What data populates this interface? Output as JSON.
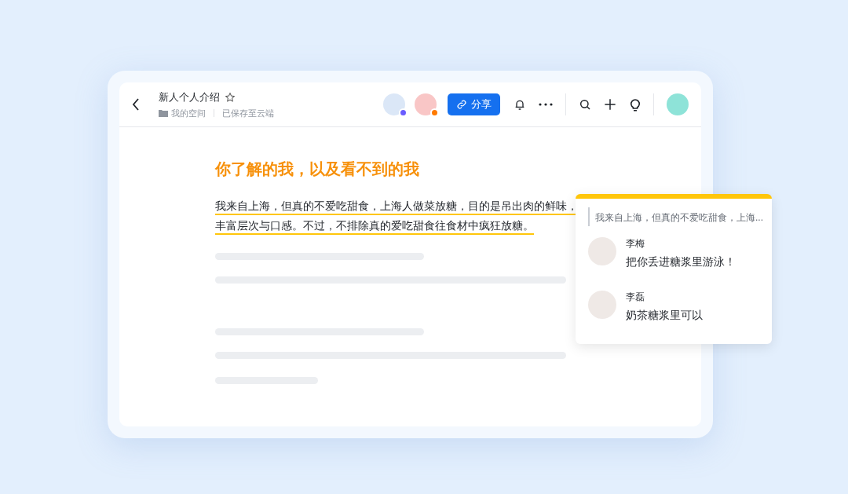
{
  "header": {
    "title": "新人个人介绍",
    "folder": "我的空间",
    "save_status": "已保存至云端",
    "collaborators": [
      {
        "color": "#6a5cff"
      },
      {
        "color": "#ff7a00"
      }
    ],
    "share_button": "分享"
  },
  "document": {
    "heading": "你了解的我，以及看不到的我",
    "paragraph": "我来自上海，但真的不爱吃甜食，上海人做菜放糖，目的是吊出肉的鲜味，丰富层次与口感。不过，不排除真的爱吃甜食往食材中疯狂放糖。"
  },
  "comment": {
    "quote": "我来自上海，但真的不爱吃甜食，上海...",
    "replies": [
      {
        "author": "李梅",
        "text": "把你丢进糖浆里游泳！"
      },
      {
        "author": "李磊",
        "text": "奶茶糖浆里可以"
      }
    ]
  }
}
